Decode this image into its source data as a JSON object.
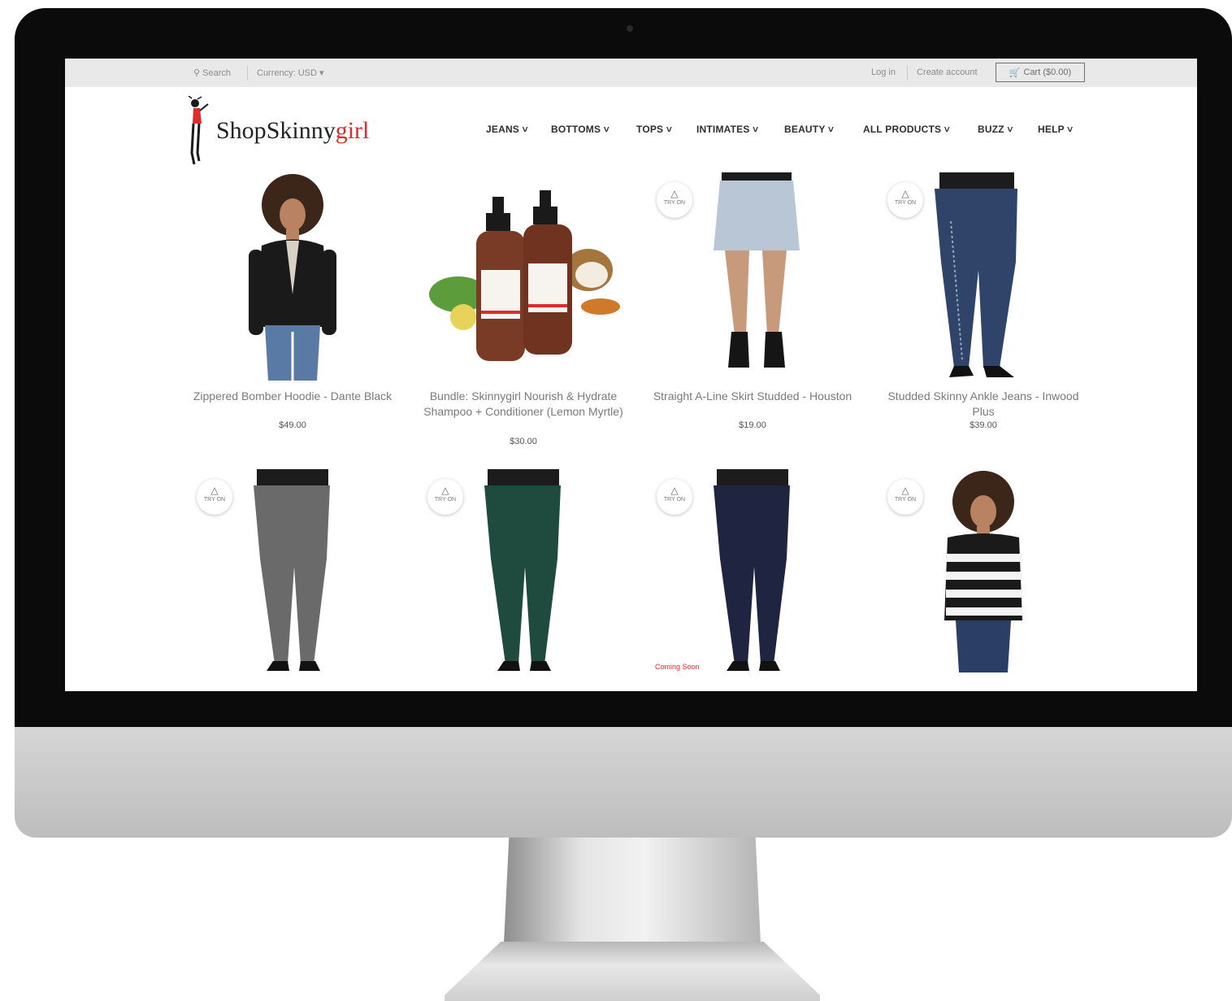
{
  "topbar": {
    "search_label": "Search",
    "currency_label": "Currency: USD",
    "login_label": "Log in",
    "create_account_label": "Create account",
    "cart_label": "Cart ($0.00)"
  },
  "brand": {
    "logo_left": "Shop",
    "logo_mid": "Skinny",
    "logo_right": "girl",
    "accent_color": "#e02b2b"
  },
  "nav": {
    "items": [
      {
        "label": "JEANS"
      },
      {
        "label": "BOTTOMS"
      },
      {
        "label": "TOPS"
      },
      {
        "label": "INTIMATES"
      },
      {
        "label": "BEAUTY"
      },
      {
        "label": "ALL PRODUCTS"
      },
      {
        "label": "BUZZ"
      },
      {
        "label": "HELP"
      }
    ]
  },
  "products": [
    {
      "title": "Zippered Bomber Hoodie - Dante Black",
      "price": "$49.00"
    },
    {
      "title": "Bundle: Skinnygirl Nourish & Hydrate Shampoo + Conditioner (Lemon Myrtle)",
      "price": "$30.00"
    },
    {
      "title": "Straight A-Line Skirt Studded - Houston",
      "price": "$19.00",
      "badge": "TRY ON"
    },
    {
      "title": "Studded Skinny Ankle Jeans - Inwood Plus",
      "price": "$39.00",
      "badge": "TRY ON"
    },
    {
      "title": "",
      "price": "",
      "badge": "TRY ON"
    },
    {
      "title": "",
      "price": "",
      "badge": "TRY ON"
    },
    {
      "title": "",
      "price": "",
      "badge": "TRY ON",
      "ribbon": "Coming Soon"
    },
    {
      "title": "",
      "price": "",
      "badge": "TRY ON"
    }
  ],
  "icons": {
    "search": "search-icon",
    "cart": "cart-icon",
    "hanger": "hanger-icon",
    "chevron": "chevron-down-icon"
  }
}
